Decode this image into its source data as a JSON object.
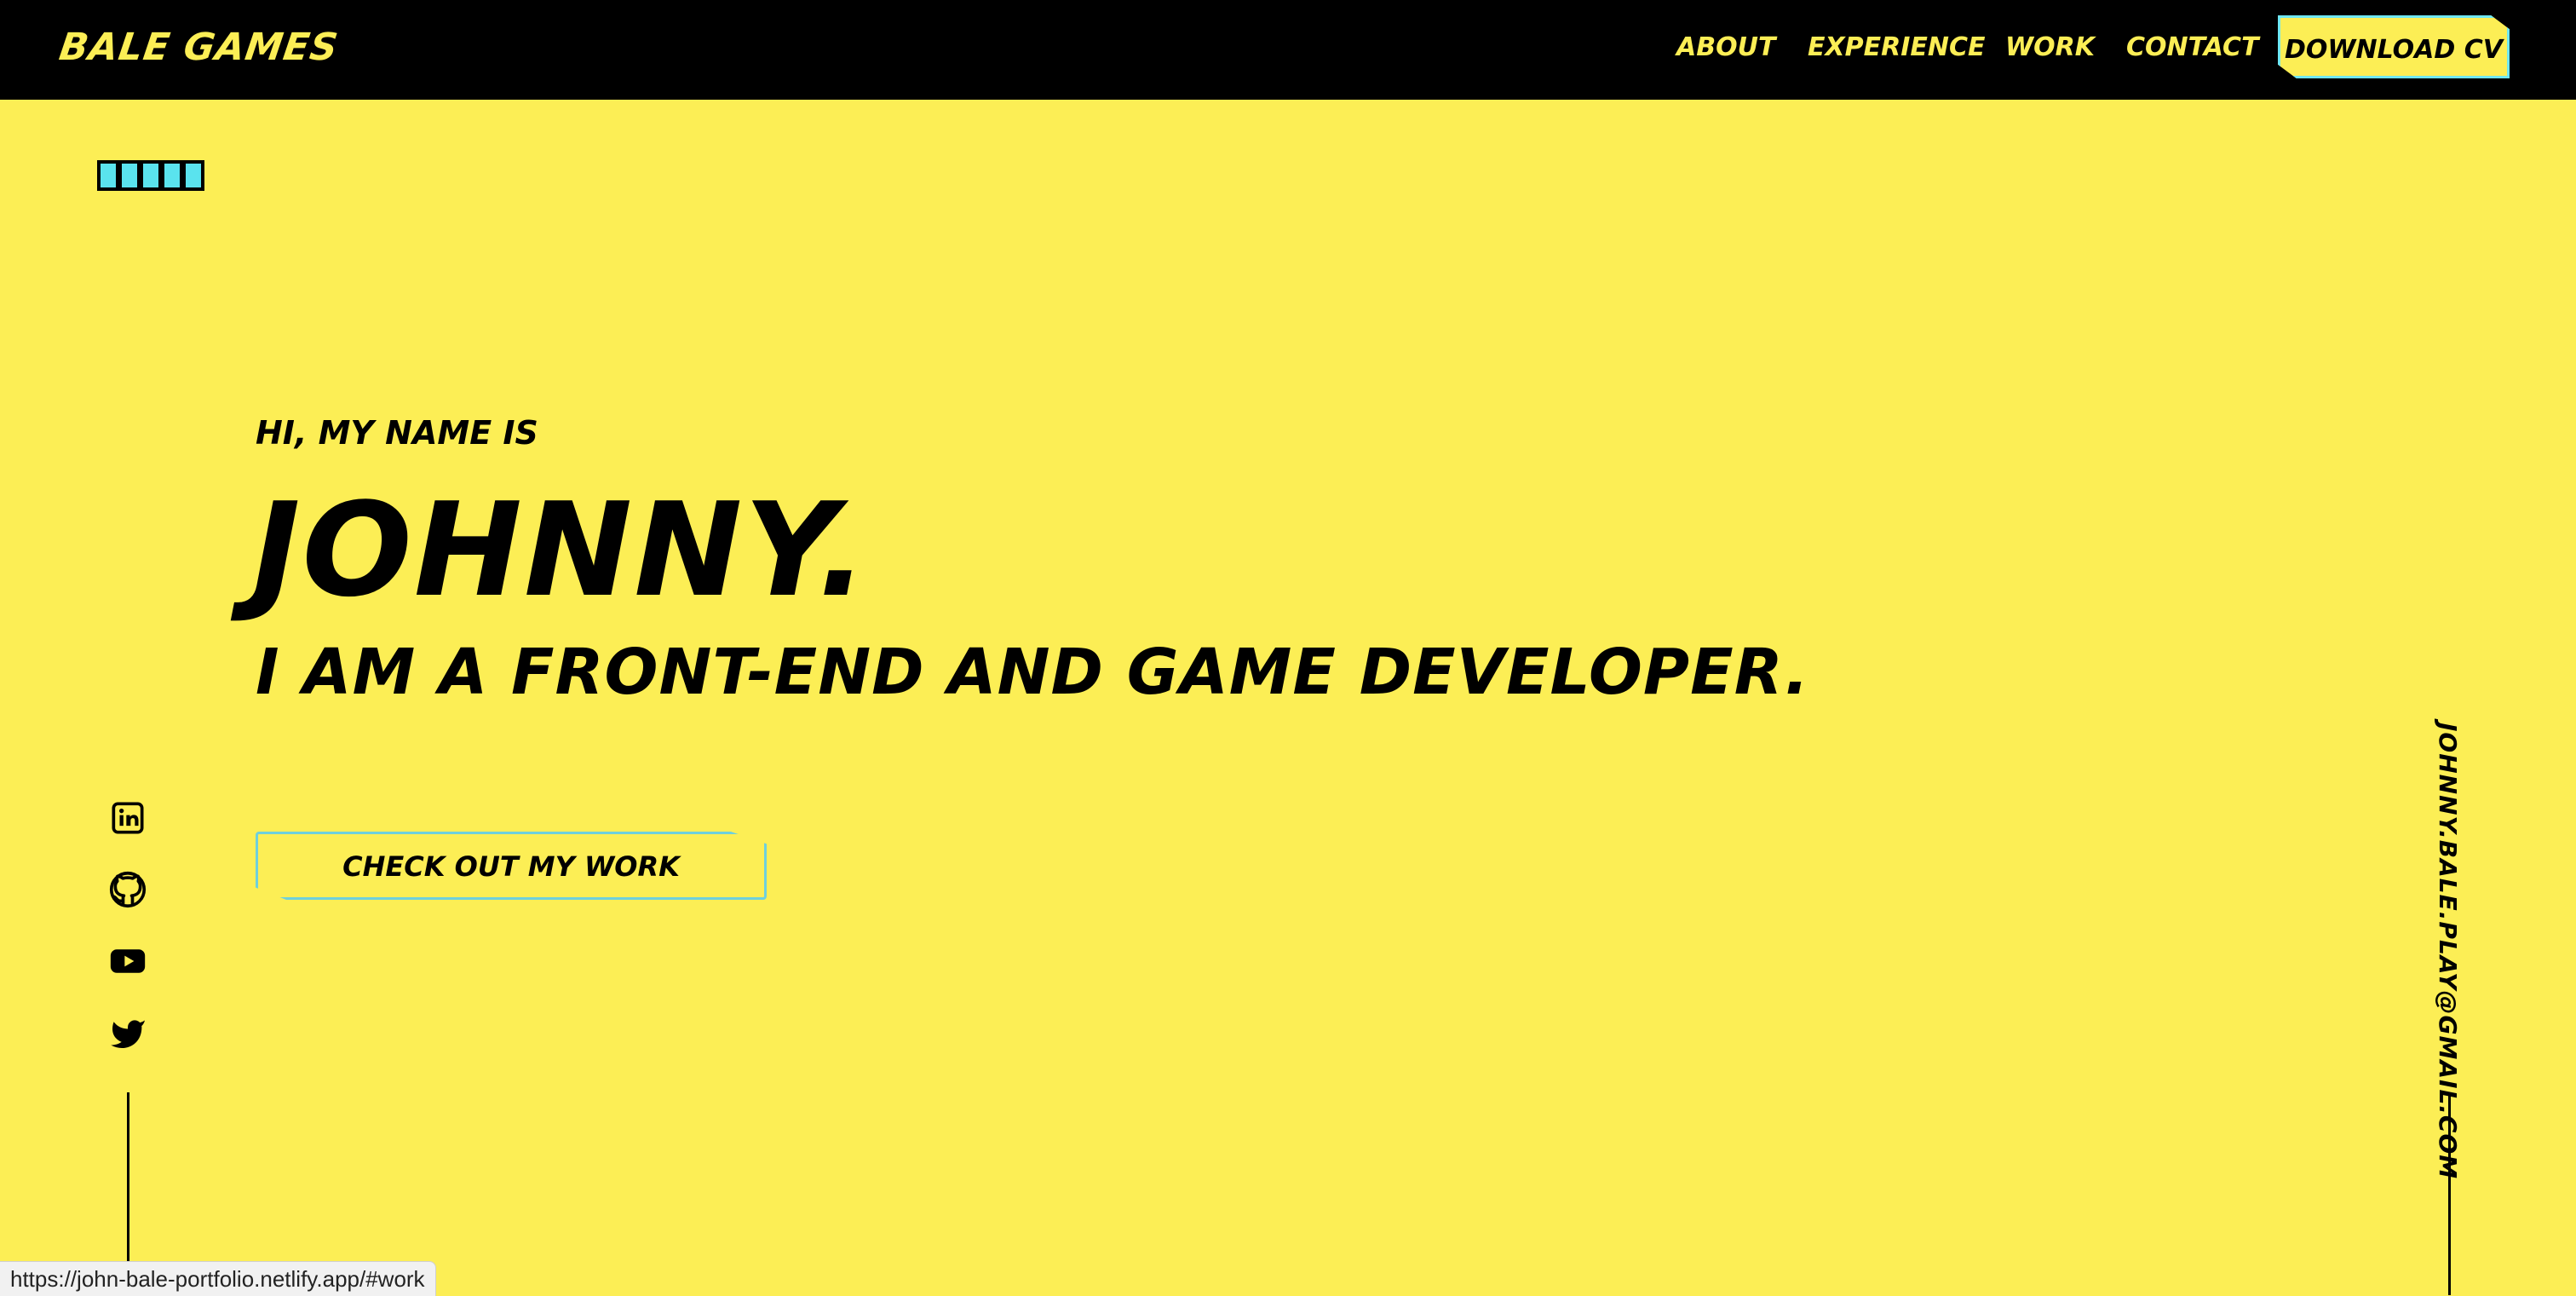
{
  "header": {
    "logo": "BALE GAMES",
    "nav": [
      {
        "label": "ABOUT"
      },
      {
        "label": "EXPERIENCE"
      },
      {
        "label": "WORK"
      },
      {
        "label": "CONTACT"
      }
    ],
    "cv_button": "DOWNLOAD CV"
  },
  "loader": {
    "squares": 5,
    "color": "#5ae3ee"
  },
  "hero": {
    "greeting": "HI, MY NAME IS",
    "name": "JOHNNY.",
    "role": "I AM A FRONT-END AND GAME DEVELOPER.",
    "cta": "CHECK OUT MY WORK"
  },
  "socials": [
    {
      "icon": "linkedin-icon"
    },
    {
      "icon": "github-icon"
    },
    {
      "icon": "youtube-icon"
    },
    {
      "icon": "twitter-icon"
    }
  ],
  "contact": {
    "email": "JOHNNY.BALE.PLAY@GMAIL.COM"
  },
  "status_bar": {
    "url": "https://john-bale-portfolio.netlify.app/#work"
  },
  "colors": {
    "background": "#fcee55",
    "header": "#000000",
    "accent": "#5ae3ee"
  }
}
